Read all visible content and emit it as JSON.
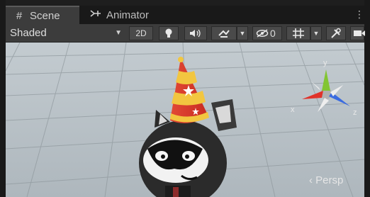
{
  "tabs": [
    {
      "label": "Scene",
      "icon": "hash-grid-icon",
      "active": true
    },
    {
      "label": "Animator",
      "icon": "animator-icon",
      "active": false
    }
  ],
  "toolbar": {
    "shading_mode": "Shaded",
    "mode_2d_label": "2D",
    "hidden_count": "0"
  },
  "scene": {
    "projection_label": "Persp",
    "gizmo_axes": {
      "x": "x",
      "y": "y",
      "z": "z"
    }
  },
  "colors": {
    "tab_bar": "#191919",
    "toolbar": "#3c3c3c",
    "sky": "#b9c2c8",
    "ground": "#9aa3a8",
    "gizmo_x": "#e0322a",
    "gizmo_y": "#82c532",
    "gizmo_z": "#3a6be0",
    "hat_red": "#d9342a",
    "hat_yellow": "#f2c640"
  }
}
